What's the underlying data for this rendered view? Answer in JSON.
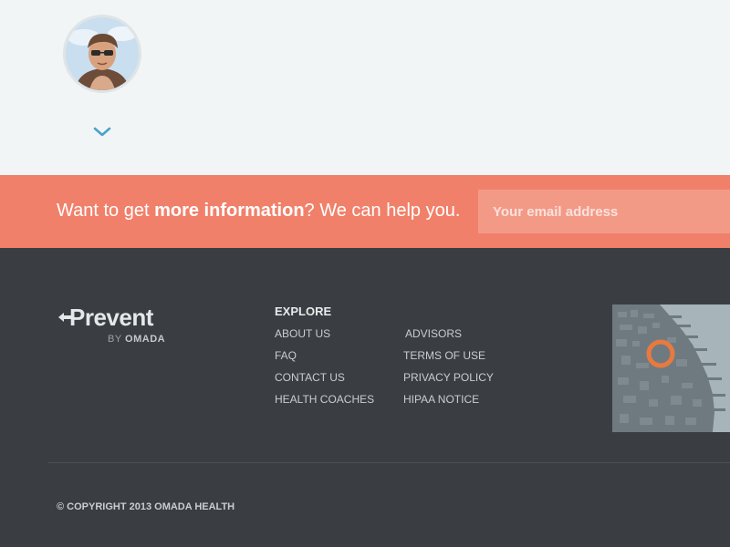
{
  "cta": {
    "text_before": "Want to get ",
    "text_bold": "more information",
    "text_after": "? We can help you.",
    "email_placeholder": "Your email address"
  },
  "footer": {
    "logo_word": "Prevent",
    "logo_by": "BY ",
    "logo_brand": "OMADA",
    "explore_title": "EXPLORE",
    "links_col1": [
      "ABOUT US",
      "FAQ",
      "CONTACT US",
      "HEALTH COACHES"
    ],
    "links_col2": [
      "ADVISORS",
      "TERMS OF USE",
      "PRIVACY POLICY",
      "HIPAA NOTICE"
    ],
    "copyright": "© COPYRIGHT 2013 OMADA HEALTH"
  },
  "colors": {
    "cta_bg": "#f1806a",
    "footer_bg": "#3a3e42",
    "accent_blue": "#4aa3c8",
    "map_marker": "#e8793f"
  },
  "icons": {
    "expand": "chevron-down-icon",
    "logo_arrow": "arrow-left-icon",
    "map_marker": "location-ring-icon"
  }
}
